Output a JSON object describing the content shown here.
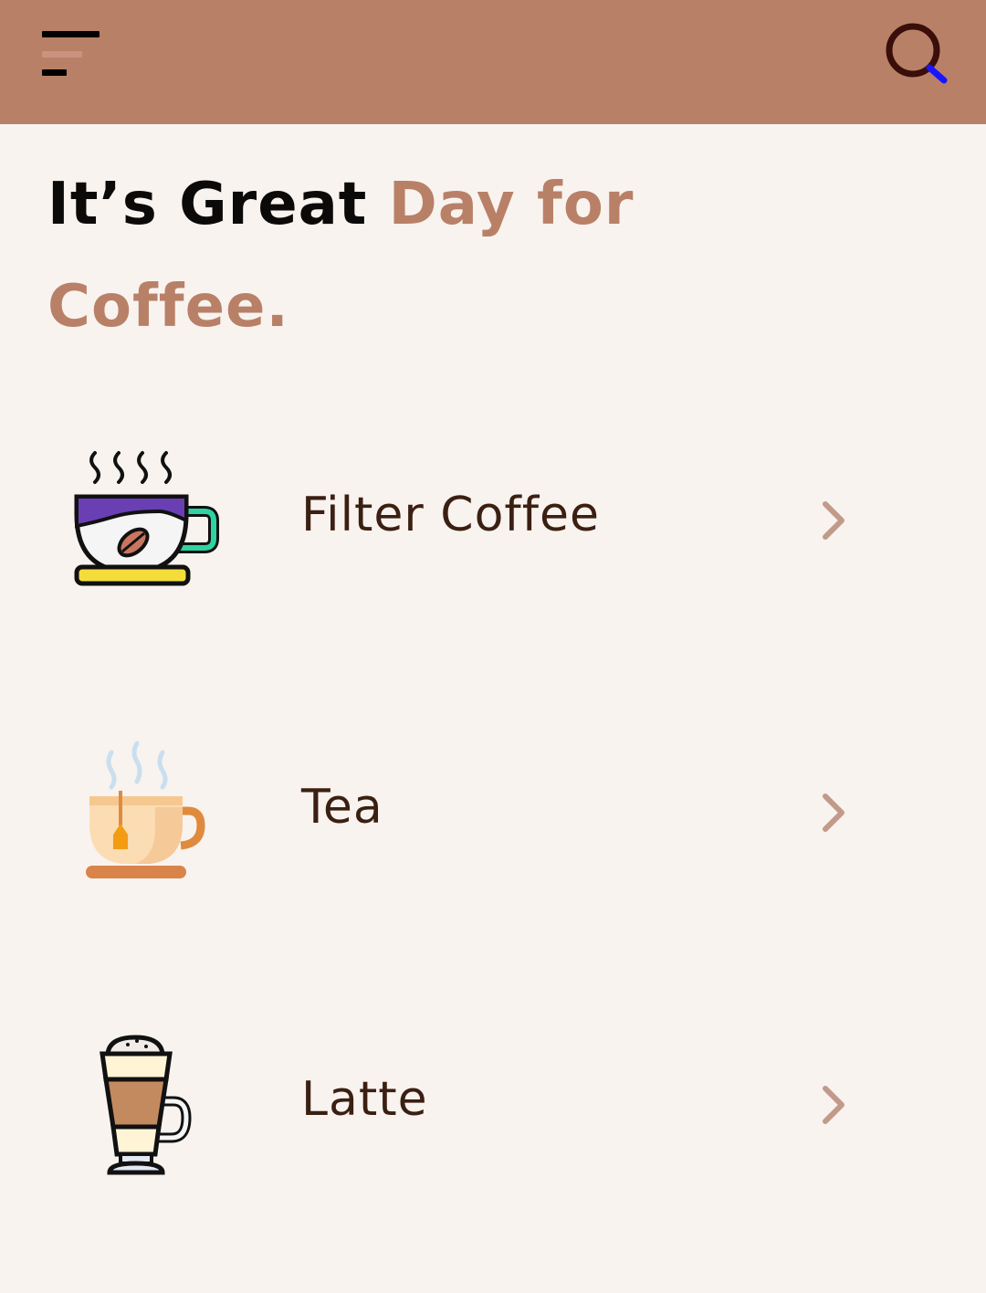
{
  "header": {
    "menu_icon": "menu-icon",
    "search_icon": "search-icon",
    "background_color": "#b98068"
  },
  "headline": {
    "part1": "It’s Great ",
    "part2": "Day for Coffee.",
    "dark_color": "#0c0a09",
    "accent_color": "#b98068"
  },
  "categories": [
    {
      "label": "Filter Coffee",
      "icon": "filter-coffee-icon",
      "chevron": "chevron-right-icon"
    },
    {
      "label": "Tea",
      "icon": "tea-cup-icon",
      "chevron": "chevron-right-icon"
    },
    {
      "label": "Latte",
      "icon": "latte-glass-icon",
      "chevron": "chevron-right-icon"
    }
  ]
}
